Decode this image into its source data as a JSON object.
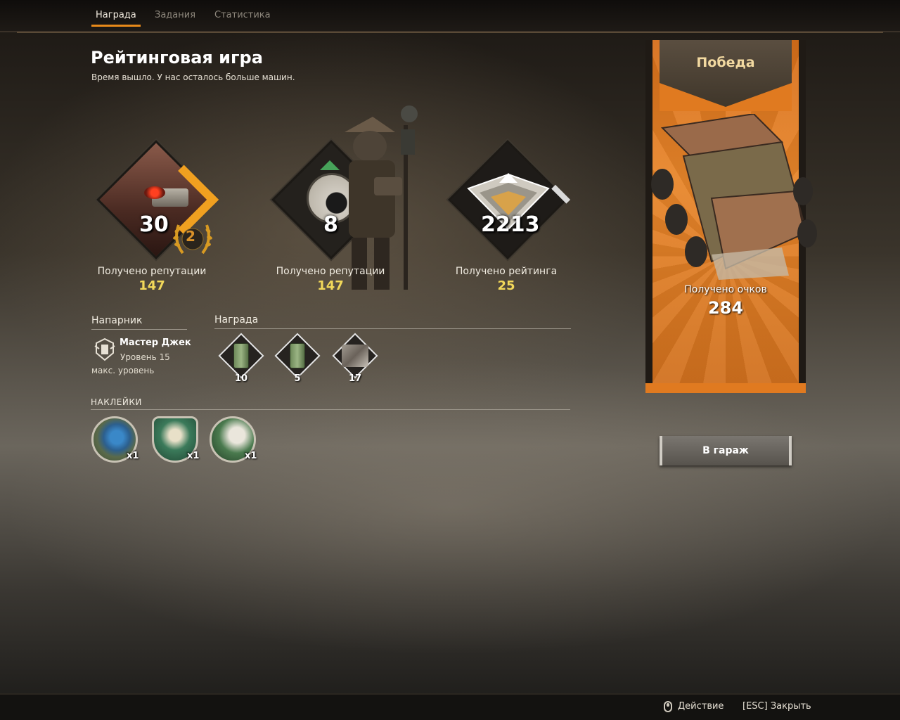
{
  "tabs": [
    {
      "label": "Награда",
      "active": true
    },
    {
      "label": "Задания",
      "active": false
    },
    {
      "label": "Статистика",
      "active": false
    }
  ],
  "header": {
    "title": "Рейтинговая игра",
    "subtitle": "Время вышло. У нас осталось больше машин."
  },
  "stats": [
    {
      "number": "30",
      "badge": "2",
      "label": "Получено репутации",
      "value": "147"
    },
    {
      "number": "8",
      "label": "Получено репутации",
      "value": "147"
    },
    {
      "number": "2213",
      "label": "Получено рейтинга",
      "value": "25"
    }
  ],
  "partner": {
    "section_title": "Напарник",
    "name": "Мастер Джек",
    "level": "Уровень 15",
    "max_level": "макс. уровень"
  },
  "reward": {
    "section_title": "Награда",
    "items": [
      {
        "icon": "fuel-can-icon",
        "count": "10"
      },
      {
        "icon": "fuel-can-icon",
        "count": "5"
      },
      {
        "icon": "scrap-metal-icon",
        "count": "17"
      }
    ]
  },
  "stickers": {
    "section_title": "НАКЛЕЙКИ",
    "items": [
      {
        "icon": "gear-sticker-icon",
        "count": "x1"
      },
      {
        "icon": "lifter-sticker-icon",
        "count": "x1"
      },
      {
        "icon": "no-cat-sticker-icon",
        "count": "x1"
      }
    ]
  },
  "victory": {
    "title": "Победа",
    "points_label": "Получено очков",
    "points_value": "284",
    "colors": {
      "banner": "#e07a20",
      "accent": "#f0a020"
    }
  },
  "garage_button": "В гараж",
  "footer": {
    "action_hint": "Действие",
    "close_hint": "[ESC] Закрыть"
  }
}
